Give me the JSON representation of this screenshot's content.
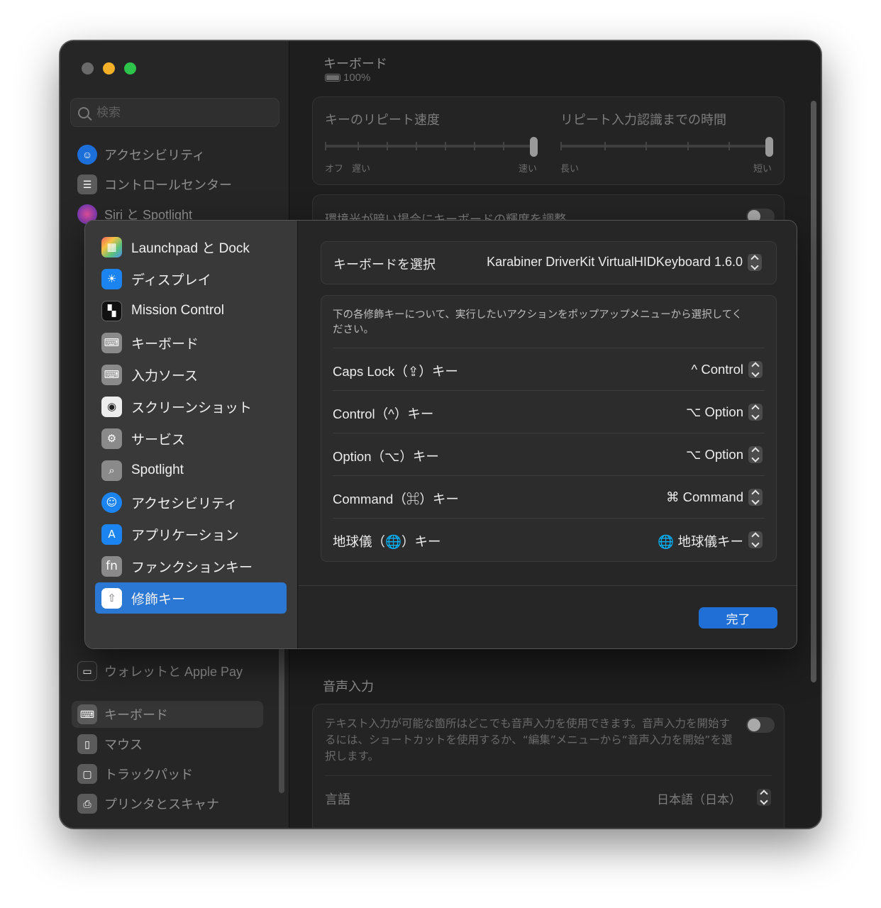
{
  "sidebar": {
    "search_placeholder": "検索",
    "items": [
      {
        "label": "アクセシビリティ",
        "icon": "accessibility-icon",
        "color": "#1c6fd8"
      },
      {
        "label": "コントロールセンター",
        "icon": "control-center-icon",
        "color": "#6b6b6b"
      },
      {
        "label": "Siri と Spotlight",
        "icon": "siri-icon",
        "color": "#6c3ad6"
      },
      {
        "label": "ウォレットと Apple Pay",
        "icon": "wallet-icon",
        "color": "#3b3b3b"
      },
      {
        "label": "キーボード",
        "icon": "keyboard-icon",
        "color": "#6b6b6b"
      },
      {
        "label": "マウス",
        "icon": "mouse-icon",
        "color": "#6b6b6b"
      },
      {
        "label": "トラックパッド",
        "icon": "trackpad-icon",
        "color": "#6b6b6b"
      },
      {
        "label": "プリンタとスキャナ",
        "icon": "printer-icon",
        "color": "#6b6b6b"
      }
    ]
  },
  "content": {
    "title": "キーボード",
    "battery": "100%",
    "repeat": {
      "speed_label": "キーのリピート速度",
      "speed_min_off": "オフ",
      "speed_min": "遅い",
      "speed_max": "速い",
      "delay_label": "リピート入力認識までの時間",
      "delay_min": "長い",
      "delay_max": "短い"
    },
    "ambient_label": "環境光が暗い場合にキーボードの輝度を調整",
    "voice": {
      "title": "音声入力",
      "description": "テキスト入力が可能な箇所はどこでも音声入力を使用できます。音声入力を開始するには、ショートカットを使用するか、“編集”メニューから“音声入力を開始”を選択します。",
      "language_label": "言語",
      "language_value": "日本語（日本）"
    }
  },
  "sheet": {
    "sidebar_items": [
      {
        "label": "Launchpad と Dock",
        "icon": "launchpad-icon"
      },
      {
        "label": "ディスプレイ",
        "icon": "display-icon"
      },
      {
        "label": "Mission Control",
        "icon": "mission-control-icon"
      },
      {
        "label": "キーボード",
        "icon": "keyboard-icon"
      },
      {
        "label": "入力ソース",
        "icon": "input-source-icon"
      },
      {
        "label": "スクリーンショット",
        "icon": "screenshot-icon"
      },
      {
        "label": "サービス",
        "icon": "services-icon"
      },
      {
        "label": "Spotlight",
        "icon": "spotlight-icon"
      },
      {
        "label": "アクセシビリティ",
        "icon": "accessibility-icon"
      },
      {
        "label": "アプリケーション",
        "icon": "app-store-icon"
      },
      {
        "label": "ファンクションキー",
        "icon": "fn-icon"
      },
      {
        "label": "修飾キー",
        "icon": "modifier-key-icon"
      }
    ],
    "keyboard_select_label": "キーボードを選択",
    "keyboard_select_value": "Karabiner DriverKit VirtualHIDKeyboard 1.6.0",
    "description": "下の各修飾キーについて、実行したいアクションをポップアップメニューから選択してください。",
    "modifiers": [
      {
        "key": "Caps Lock（⇪）キー",
        "value": "^ Control"
      },
      {
        "key": "Control（^）キー",
        "value": "⌥ Option"
      },
      {
        "key": "Option（⌥）キー",
        "value": "⌥ Option"
      },
      {
        "key": "Command（⌘）キー",
        "value": "⌘ Command"
      },
      {
        "key": "地球儀（🌐）キー",
        "value": "🌐 地球儀キー"
      }
    ],
    "done_label": "完了",
    "accent": "#2b78d4"
  }
}
